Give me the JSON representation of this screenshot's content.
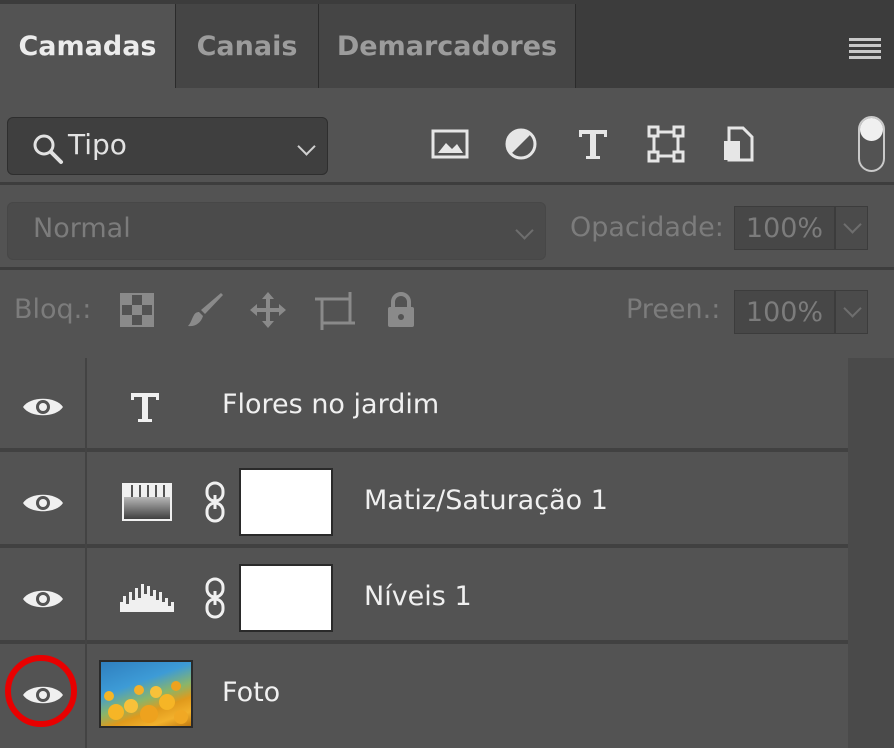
{
  "tabs": [
    {
      "label": "Camadas",
      "active": true
    },
    {
      "label": "Canais",
      "active": false
    },
    {
      "label": "Demarcadores",
      "active": false
    }
  ],
  "panel_menu_icon": "hamburger-menu-icon",
  "filter": {
    "search_icon": "magnifier-icon",
    "value": "Tipo",
    "icons": [
      "image-filter-icon",
      "adjustment-filter-icon",
      "type-filter-icon",
      "shape-filter-icon",
      "smart-object-filter-icon"
    ]
  },
  "blend": {
    "mode": "Normal",
    "opacity_label": "Opacidade:",
    "opacity_value": "100%"
  },
  "lock": {
    "label": "Bloq.:",
    "icons": [
      "lock-transparent-pixels-icon",
      "lock-image-pixels-icon",
      "lock-position-icon",
      "lock-artboard-icon",
      "lock-all-icon"
    ],
    "fill_label": "Preen.:",
    "fill_value": "100%"
  },
  "layers": [
    {
      "name": "Flores no jardim",
      "type": "text",
      "visible": true
    },
    {
      "name": "Matiz/Saturação 1",
      "type": "hue-saturation",
      "visible": true
    },
    {
      "name": "Níveis 1",
      "type": "levels",
      "visible": true
    },
    {
      "name": "Foto",
      "type": "image",
      "visible": true,
      "highlighted": true
    }
  ],
  "colors": {
    "panel_bg": "#535353",
    "highlight": "#e80000"
  }
}
